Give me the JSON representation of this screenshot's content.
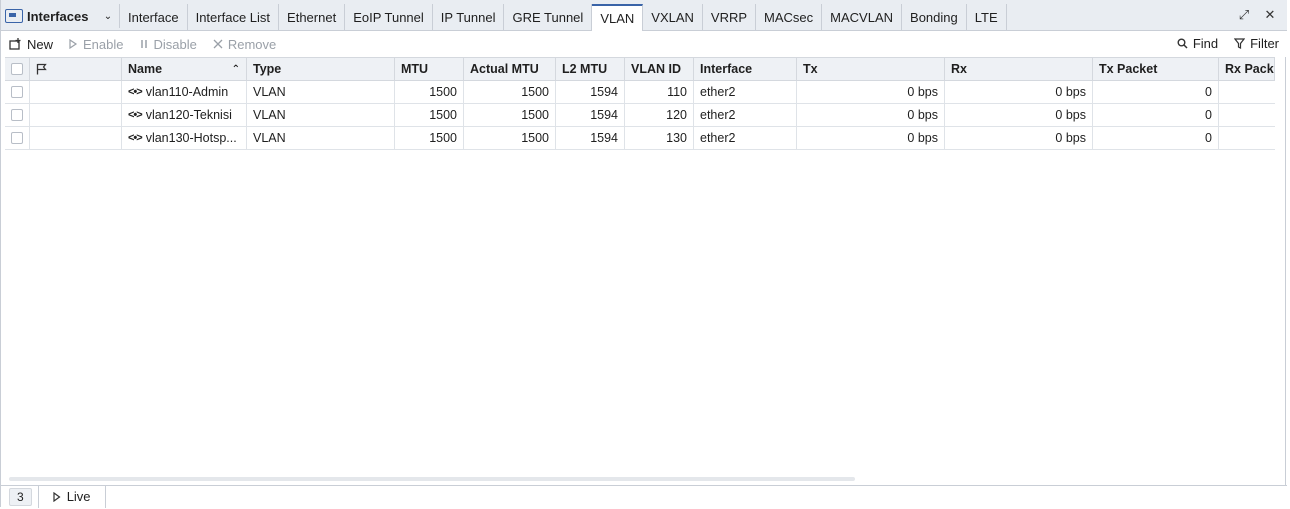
{
  "window": {
    "title": "Interfaces",
    "tabs": [
      "Interface",
      "Interface List",
      "Ethernet",
      "EoIP Tunnel",
      "IP Tunnel",
      "GRE Tunnel",
      "VLAN",
      "VXLAN",
      "VRRP",
      "MACsec",
      "MACVLAN",
      "Bonding",
      "LTE"
    ],
    "active_tab": "VLAN"
  },
  "toolbar": {
    "new_label": "New",
    "enable_label": "Enable",
    "disable_label": "Disable",
    "remove_label": "Remove",
    "find_label": "Find",
    "filter_label": "Filter"
  },
  "table": {
    "columns": [
      "Name",
      "Type",
      "MTU",
      "Actual MTU",
      "L2 MTU",
      "VLAN ID",
      "Interface",
      "Tx",
      "Rx",
      "Tx Packet",
      "Rx Packe"
    ],
    "rows": [
      {
        "name": "vlan110-Admin",
        "type": "VLAN",
        "mtu": "1500",
        "actual_mtu": "1500",
        "l2_mtu": "1594",
        "vlan_id": "110",
        "interface": "ether2",
        "tx": "0 bps",
        "rx": "0 bps",
        "tx_packet": "0"
      },
      {
        "name": "vlan120-Teknisi",
        "type": "VLAN",
        "mtu": "1500",
        "actual_mtu": "1500",
        "l2_mtu": "1594",
        "vlan_id": "120",
        "interface": "ether2",
        "tx": "0 bps",
        "rx": "0 bps",
        "tx_packet": "0"
      },
      {
        "name": "vlan130-Hotsp...",
        "type": "VLAN",
        "mtu": "1500",
        "actual_mtu": "1500",
        "l2_mtu": "1594",
        "vlan_id": "130",
        "interface": "ether2",
        "tx": "0 bps",
        "rx": "0 bps",
        "tx_packet": "0"
      }
    ]
  },
  "status": {
    "count": "3",
    "live_label": "Live"
  },
  "colors": {
    "accent": "#3a64a8",
    "tabbar": "#e9edf2"
  }
}
